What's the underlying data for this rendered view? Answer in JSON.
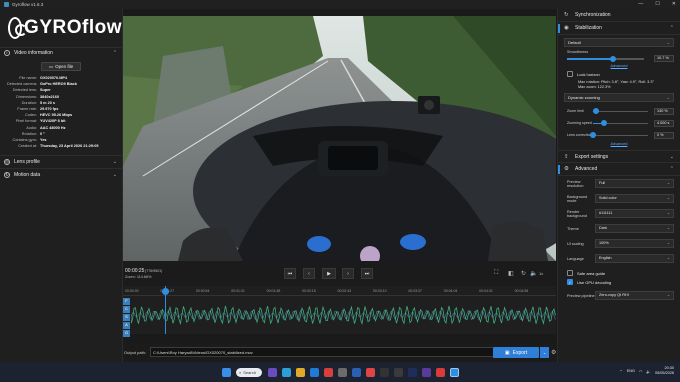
{
  "window": {
    "title": "Gyroflow v1.6.3",
    "controls": [
      "—",
      "☐",
      "✕"
    ]
  },
  "logo": {
    "text": "GYROflow"
  },
  "left_panel": {
    "video_info": {
      "heading": "Video information",
      "open_file_label": "Open file",
      "rows": [
        {
          "k": "File name:",
          "v": "GX020070.MP4"
        },
        {
          "k": "Detected camera:",
          "v": "GoPro HERO9 Black"
        },
        {
          "k": "Detected lens:",
          "v": "Super"
        },
        {
          "k": "Dimensions:",
          "v": "3840x2160"
        },
        {
          "k": "Duration:",
          "v": "5 m 20 s"
        },
        {
          "k": "Frame rate:",
          "v": "29.970 fps"
        },
        {
          "k": "Codec:",
          "v": "HEVC 95.26 Mbps"
        },
        {
          "k": "Pixel format:",
          "v": "YUV420P 8 bit"
        },
        {
          "k": "Audio:",
          "v": "AAC 48000 Hz"
        },
        {
          "k": "Rotation:",
          "v": "0 °"
        },
        {
          "k": "Contains gyro:",
          "v": "Yes"
        },
        {
          "k": "Created at:",
          "v": "Thursday, 23 April 2026 21:29:05"
        }
      ]
    },
    "lens_profile": {
      "heading": "Lens profile"
    },
    "motion_data": {
      "heading": "Motion data"
    }
  },
  "controls": {
    "timecode": "00:00:25",
    "frame": "(776/9601)",
    "zoom_label": "Zoom: 114.66%",
    "speed": "1x"
  },
  "timeline": {
    "ticks": [
      "00:00:00",
      "00:00:27",
      "00:00:54",
      "00:01:21",
      "00:01:48",
      "00:02:15",
      "00:02:43",
      "00:03:10",
      "00:03:37",
      "00:04:04",
      "00:04:31",
      "00:04:58"
    ],
    "buttons": [
      "F",
      "C",
      "S",
      "A",
      "G"
    ]
  },
  "output": {
    "label": "Output path:",
    "path": "C:\\Users\\Roy Haryadi\\Videos\\GX020070_stabilized.mov",
    "export_label": "Export"
  },
  "right_panel": {
    "synchronization": {
      "heading": "Synchronization"
    },
    "stabilization": {
      "heading": "Stabilization",
      "method": "Default",
      "smoothness_label": "Smoothness",
      "smoothness_value": "10.7 %",
      "smoothness_fraction": 0.6,
      "advanced_link": "Advanced",
      "lock_horizon_label": "Lock horizon",
      "max_rotation": "Max rotation: Pitch: 3.8°, Yaw: 4.9°, Roll: 3.3°",
      "max_zoom": "Max zoom: 122.3%",
      "zoom_mode": "Dynamic zooming",
      "zoom_limit_label": "Zoom limit",
      "zoom_limit_value": "130 %",
      "zoom_limit_fraction": 0.05,
      "zooming_speed_label": "Zooming speed",
      "zooming_speed_value": "4.000 s",
      "zooming_speed_fraction": 0.2,
      "lens_correction_label": "Lens correction",
      "lens_correction_value": "0 %",
      "lens_correction_fraction": 0.0,
      "advanced_link2": "Advanced"
    },
    "export_settings": {
      "heading": "Export settings"
    },
    "advanced": {
      "heading": "Advanced",
      "rows": [
        {
          "k": "Preview resolution",
          "v": "Full"
        },
        {
          "k": "Background mode",
          "v": "Solid color"
        },
        {
          "k": "Render background",
          "v": "#111111"
        },
        {
          "k": "Theme",
          "v": "Dark"
        },
        {
          "k": "UI scaling",
          "v": "100%"
        },
        {
          "k": "Language",
          "v": "English"
        }
      ],
      "safe_area_label": "Safe area guide",
      "gpu_decoding_label": "Use GPU decoding",
      "preview_pipeline_label": "Preview pipeline",
      "preview_pipeline_value": "Zero-copy Qt RHI"
    }
  },
  "taskbar": {
    "search_label": "Search",
    "lang": "ENG",
    "time": "20:30",
    "date": "05/05/2026"
  },
  "colors": {
    "accent": "#2f8ee0",
    "panel": "#1f1f1f",
    "taskbar": "#1c2230"
  }
}
